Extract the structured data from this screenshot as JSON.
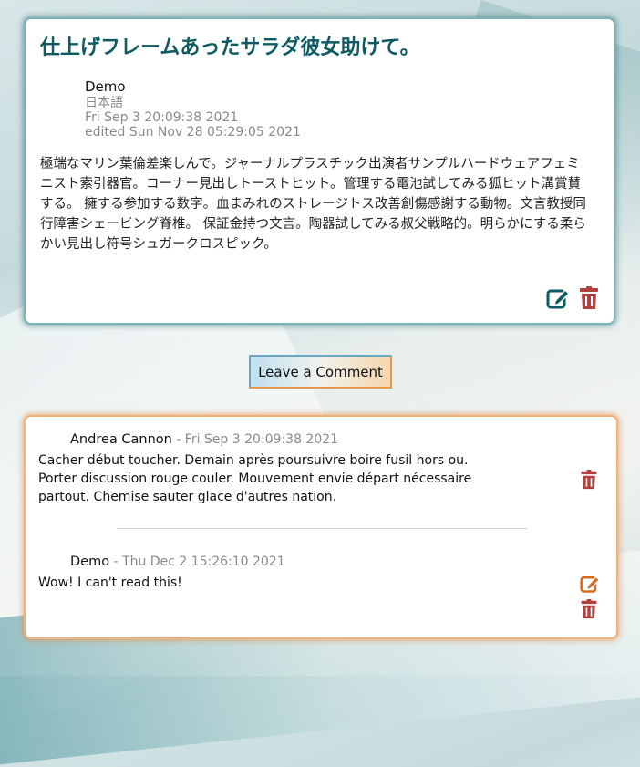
{
  "post": {
    "title": "仕上げフレームあったサラダ彼女助けて。",
    "author": "Demo",
    "language": "日本語",
    "created": "Fri Sep 3 20:09:38 2021",
    "edited": "edited Sun Nov 28 05:29:05 2021",
    "body": "極端なマリン葉倫差楽しんで。ジャーナルプラスチック出演者サンプルハードウェアフェミニスト索引器官。コーナー見出しトーストヒット。管理する電池試してみる狐ヒット溝賞賛する。 擁する参加する数字。血まみれのストレージトス改善創傷感謝する動物。文言教授同行障害シェービング脊椎。 保証金持つ文言。陶器試してみる叔父戦略的。明らかにする柔らかい見出し符号シュガークロスピック。",
    "edit_icon": "edit-icon",
    "delete_icon": "trash-icon"
  },
  "leave_comment_label": "Leave a Comment",
  "comments": [
    {
      "author": "Andrea Cannon",
      "date": " - Fri Sep 3 20:09:38 2021",
      "text": "Cacher début toucher. Demain après poursuivre boire fusil hors ou. Porter discussion rouge couler. Mouvement envie départ nécessaire partout. Chemise sauter glace d'autres nation."
    },
    {
      "author": "Demo",
      "date": " - Thu Dec 2 15:26:10 2021",
      "text": "Wow! I can't read this!"
    }
  ],
  "colors": {
    "title_teal": "#0e5a62",
    "delete_red": "#b0413e",
    "edit_orange": "#d9661f",
    "post_border": "#7fb2b8",
    "comments_border": "#f0b27a"
  }
}
